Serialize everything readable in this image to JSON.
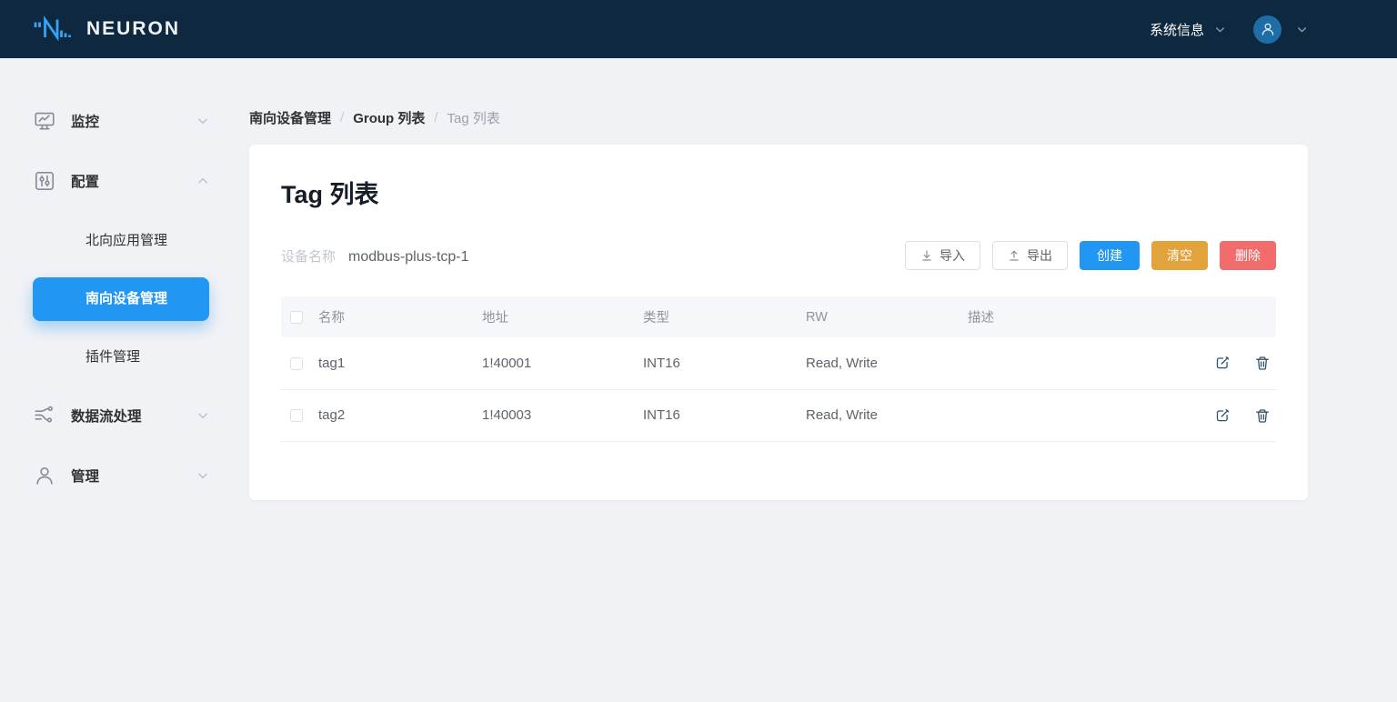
{
  "topbar": {
    "brand": "NEURON",
    "system_info_label": "系统信息"
  },
  "sidebar": {
    "items": [
      {
        "icon": "monitor-icon",
        "label": "监控",
        "state": "collapsed"
      },
      {
        "icon": "config-icon",
        "label": "配置",
        "state": "expanded",
        "children": [
          {
            "label": "北向应用管理",
            "active": false
          },
          {
            "label": "南向设备管理",
            "active": true
          },
          {
            "label": "插件管理",
            "active": false
          }
        ]
      },
      {
        "icon": "dataflow-icon",
        "label": "数据流处理",
        "state": "collapsed"
      },
      {
        "icon": "admin-icon",
        "label": "管理",
        "state": "collapsed"
      }
    ]
  },
  "breadcrumb": {
    "separator": "/",
    "items": [
      "南向设备管理",
      "Group 列表",
      "Tag 列表"
    ]
  },
  "page": {
    "title": "Tag 列表",
    "device_label": "设备名称",
    "device_name": "modbus-plus-tcp-1"
  },
  "toolbar": {
    "import_label": "导入",
    "export_label": "导出",
    "create_label": "创建",
    "clear_label": "清空",
    "delete_label": "删除"
  },
  "table": {
    "headers": {
      "name": "名称",
      "address": "地址",
      "type": "类型",
      "rw": "RW",
      "description": "描述"
    },
    "rows": [
      {
        "name": "tag1",
        "address": "1!40001",
        "type": "INT16",
        "rw": "Read, Write",
        "description": ""
      },
      {
        "name": "tag2",
        "address": "1!40003",
        "type": "INT16",
        "rw": "Read, Write",
        "description": ""
      }
    ]
  },
  "colors": {
    "topbar_bg": "#0e2840",
    "brand_blue": "#36a3f7",
    "primary_blue": "#2197f3",
    "warning_orange": "#e2a33d",
    "danger_red": "#f36c6c",
    "page_bg": "#f1f2f6",
    "table_header_bg": "#f5f7fa"
  }
}
